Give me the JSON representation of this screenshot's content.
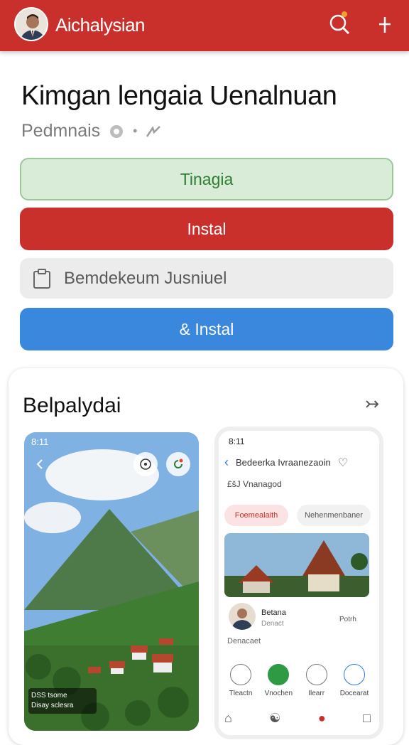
{
  "header": {
    "app_title": "Aichalysian",
    "bg_color": "#c9302c"
  },
  "main": {
    "heading": "Kimgan lengaia Uenalnuan",
    "subtitle": "Pedmnais",
    "buttons": {
      "primary_light": "Tinagia",
      "install_red": "Instal",
      "install_blue": "& Instal"
    },
    "input": {
      "value": "Bemdekeum Jusniuel"
    }
  },
  "card": {
    "title": "Belpalydai",
    "arrow": "↣"
  },
  "phone_left": {
    "status_time": "8:11",
    "caption_line1": "DSS tsome",
    "caption_line2": "Disay sclesra"
  },
  "phone_right": {
    "status_time": "8:11",
    "header_title": "Bedeerka Ivraanezaoin",
    "sub_label": "£šJ Vnanagod",
    "tab_active": "Foemealaith",
    "tab_inactive": "Nehenmenbaner",
    "profile_name": "Betana",
    "profile_role": "Denact",
    "profile_action": "Potrh",
    "info_row": "Denacaet",
    "icons": [
      "Tleactn",
      "Vnochen",
      "Ilearr",
      "Docearat"
    ]
  }
}
